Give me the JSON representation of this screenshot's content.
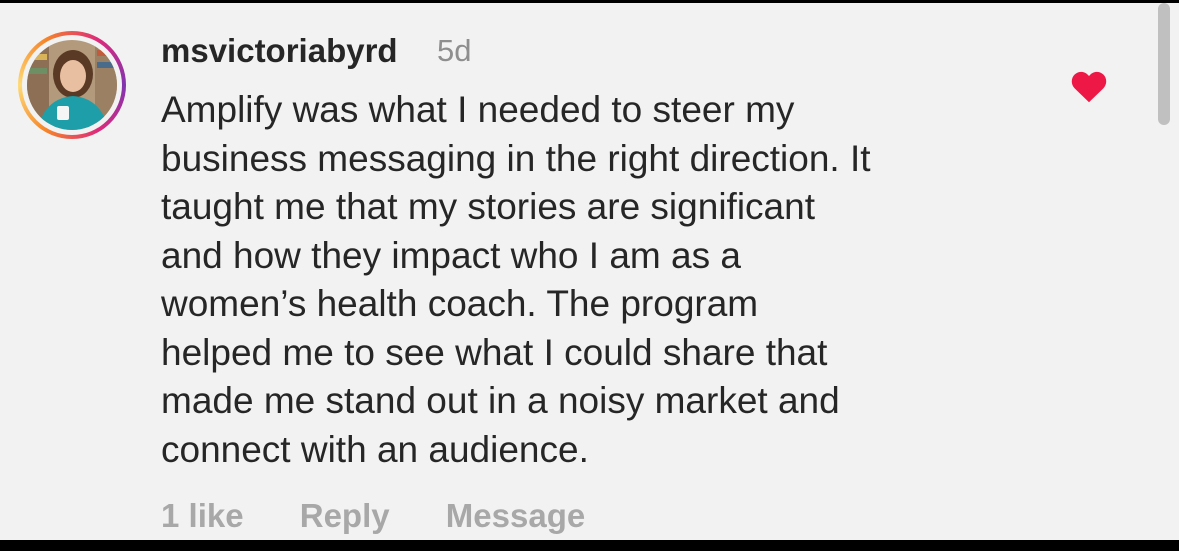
{
  "comment": {
    "username": "msvictoriabyrd",
    "time": "5d",
    "lines": [
      "Amplify was what I needed to steer my",
      "business messaging in the right direction. It",
      "taught me that my stories are significant",
      "and how they impact who I am as a",
      "women’s health coach. The program",
      "helped me to see what I could share that",
      "made me stand out in a noisy market and",
      "connect with an audience."
    ],
    "actions": {
      "likes": "1 like",
      "reply": "Reply",
      "message": "Message"
    },
    "liked": true
  },
  "icons": {
    "like": "heart-icon"
  },
  "colors": {
    "background": "#f2f2f2",
    "text": "#262626",
    "muted": "#8e8e8e",
    "action": "#a8a8a8",
    "heart": "#ed1846"
  }
}
